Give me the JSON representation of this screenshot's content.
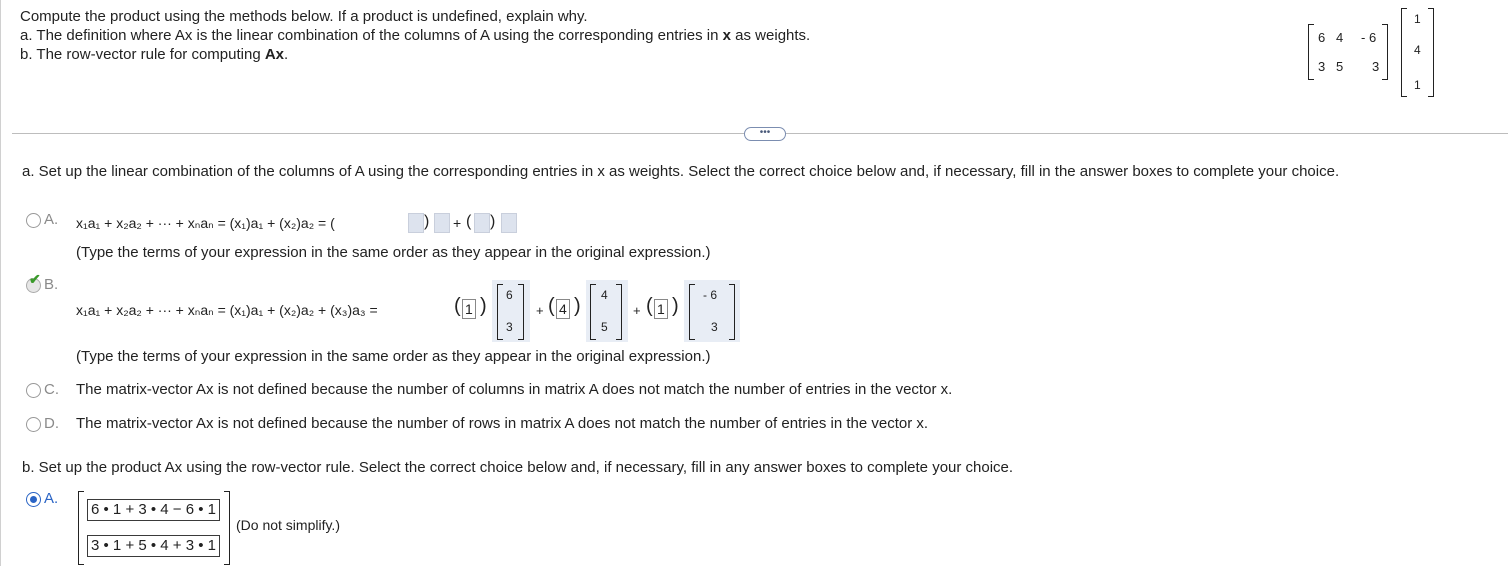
{
  "intro": {
    "line1": "Compute the product using the methods below. If a product is undefined, explain why.",
    "line2a": "a. The definition where Ax is the linear combination of the columns of A using the corresponding entries in",
    "line2b": "x",
    "line2c": "as weights.",
    "line3a": "b. The row-vector rule for computing",
    "line3b": "Ax",
    "line3c": "."
  },
  "matrixA": {
    "r1": [
      "6",
      "4",
      "- 6"
    ],
    "r2": [
      "3",
      "5",
      "3"
    ]
  },
  "vectorX": [
    "1",
    "4",
    "1"
  ],
  "more_button": "•••",
  "partA": {
    "prompt": "a. Set up the linear combination of the columns of A using the corresponding entries in x as weights. Select the correct choice below and, if necessary, fill in the answer boxes to complete your choice.",
    "optA_letter": "A.",
    "optA_lhs": "x₁a₁ + x₂a₂ + ··· + xₙaₙ = (x₁)a₁ + (x₂)a₂ = (",
    "optA_note": "(Type the terms of your expression in the same order as they appear in the original expression.)",
    "optB_letter": "B.",
    "optB_lhs": "x₁a₁ + x₂a₂ + ··· + xₙaₙ = (x₁)a₁ + (x₂)a₂ + (x₃)a₃ =",
    "w1": "1",
    "c1": [
      "6",
      "3"
    ],
    "w2": "4",
    "c2": [
      "4",
      "5"
    ],
    "w3": "1",
    "c3": [
      "- 6",
      "3"
    ],
    "plus": "+",
    "optB_note": "(Type the terms of your expression in the same order as they appear in the original expression.)",
    "optC_letter": "C.",
    "optC_text": "The matrix-vector Ax is not defined because the number of columns in matrix A does not match the number of entries in the vector x.",
    "optD_letter": "D.",
    "optD_text": "The matrix-vector Ax is not defined because the number of rows in matrix A does not match the number of entries in the vector x."
  },
  "partB": {
    "prompt": "b. Set up the product Ax using the row-vector rule. Select the correct choice below and, if necessary, fill in any answer boxes to complete your choice.",
    "optA_letter": "A.",
    "row1": "6 • 1 + 3 • 4 − 6 • 1",
    "row2": "3 • 1 + 5 • 4 + 3 • 1",
    "note": "(Do not simplify.)"
  }
}
